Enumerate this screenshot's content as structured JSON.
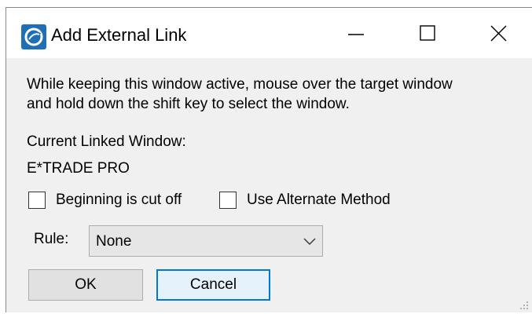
{
  "window": {
    "title": "Add External Link",
    "app_icon": "app-logo-icon",
    "controls": {
      "minimize_icon": "minimize-icon",
      "maximize_icon": "maximize-icon",
      "close_icon": "close-icon"
    }
  },
  "instructions": {
    "line1": "While keeping this window active, mouse over the target window",
    "line2": "and hold down the shift key to select the window."
  },
  "linked": {
    "label": "Current Linked Window:",
    "value": "E*TRADE PRO"
  },
  "options": {
    "beginning_cut_off": {
      "label": "Beginning is cut off",
      "checked": false
    },
    "alternate_method": {
      "label": "Use Alternate Method",
      "checked": false
    }
  },
  "rule": {
    "label": "Rule:",
    "selected": "None"
  },
  "buttons": {
    "ok": "OK",
    "cancel": "Cancel"
  },
  "colors": {
    "accent": "#0078d7",
    "dialog_bg": "#f0f0f0",
    "titlebar_bg": "#ffffff",
    "icon_blue": "#1f6fb6"
  }
}
